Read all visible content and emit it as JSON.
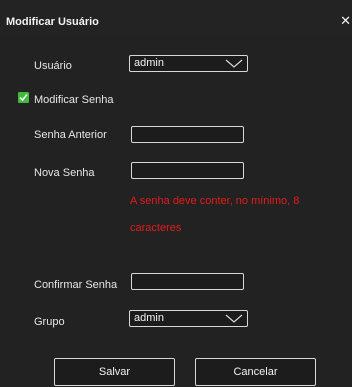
{
  "dialog": {
    "title": "Modificar Usuário",
    "close_label": "✕"
  },
  "user": {
    "label": "Usuário",
    "selected": "admin"
  },
  "modify_password": {
    "label": "Modificar Senha",
    "checked": true
  },
  "old_password": {
    "label": "Senha Anterior",
    "value": ""
  },
  "new_password": {
    "label": "Nova Senha",
    "value": "",
    "error_line1": "A senha deve conter, no mínimo, 8",
    "error_line2": "caracteres"
  },
  "confirm_password": {
    "label": "Confirmar Senha",
    "value": ""
  },
  "group": {
    "label": "Grupo",
    "selected": "admin"
  },
  "buttons": {
    "save": "Salvar",
    "cancel": "Cancelar"
  },
  "colors": {
    "checkbox": "#3dbb3b",
    "error": "#e21b1b",
    "background": "#222222"
  },
  "icons": {
    "close": "close-icon",
    "chevron": "chevron-down-icon",
    "check": "checkmark-icon"
  }
}
